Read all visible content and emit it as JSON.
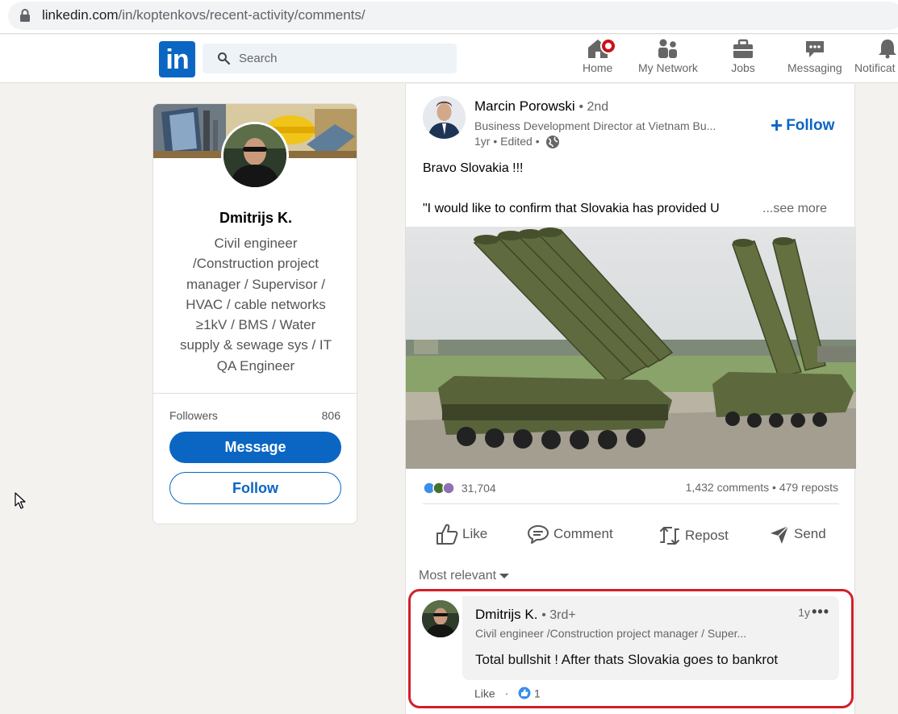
{
  "browser": {
    "url_domain": "linkedin.com",
    "url_path": "/in/koptenkovs/recent-activity/comments/"
  },
  "nav": {
    "logo_text": "in",
    "search_placeholder": "Search",
    "items": [
      {
        "label": "Home",
        "icon": "home-icon"
      },
      {
        "label": "My Network",
        "icon": "network-icon"
      },
      {
        "label": "Jobs",
        "icon": "briefcase-icon"
      },
      {
        "label": "Messaging",
        "icon": "messaging-icon"
      },
      {
        "label": "Notificat",
        "icon": "bell-icon"
      }
    ]
  },
  "profile": {
    "name": "Dmitrijs K.",
    "headline": "Civil engineer /Construction project manager / Supervisor / HVAC / cable networks ≥1kV / BMS / Water supply & sewage sys / IT QA Engineer",
    "followers_label": "Followers",
    "followers_count": "806",
    "message_label": "Message",
    "follow_label": "Follow"
  },
  "post": {
    "author": "Marcin Porowski",
    "author_degree": "• 2nd",
    "author_headline": "Business Development Director at Vietnam Bu...",
    "time": "1yr • Edited •",
    "follow_label": "Follow",
    "text_line1": "Bravo Slovakia !!!",
    "text_line2": "\"I would like to confirm that Slovakia has provided U",
    "see_more": "...see more",
    "reaction_count": "31,704",
    "comments": "1,432 comments",
    "reposts": "479 reposts",
    "stats_sep": "•",
    "actions": {
      "like": "Like",
      "comment": "Comment",
      "repost": "Repost",
      "send": "Send"
    },
    "sort_label": "Most relevant"
  },
  "comment": {
    "name": "Dmitrijs K.",
    "degree": "• 3rd+",
    "headline": "Civil engineer /Construction project manager / Super...",
    "time": "1y",
    "more": "•••",
    "text": "Total bullshit ! After thats Slovakia goes to bankrot",
    "like_label": "Like",
    "dot": "·",
    "like_count": "1"
  },
  "colors": {
    "brand": "#0a66c2",
    "highlight": "#d1202a",
    "badge": "#cc1016"
  }
}
